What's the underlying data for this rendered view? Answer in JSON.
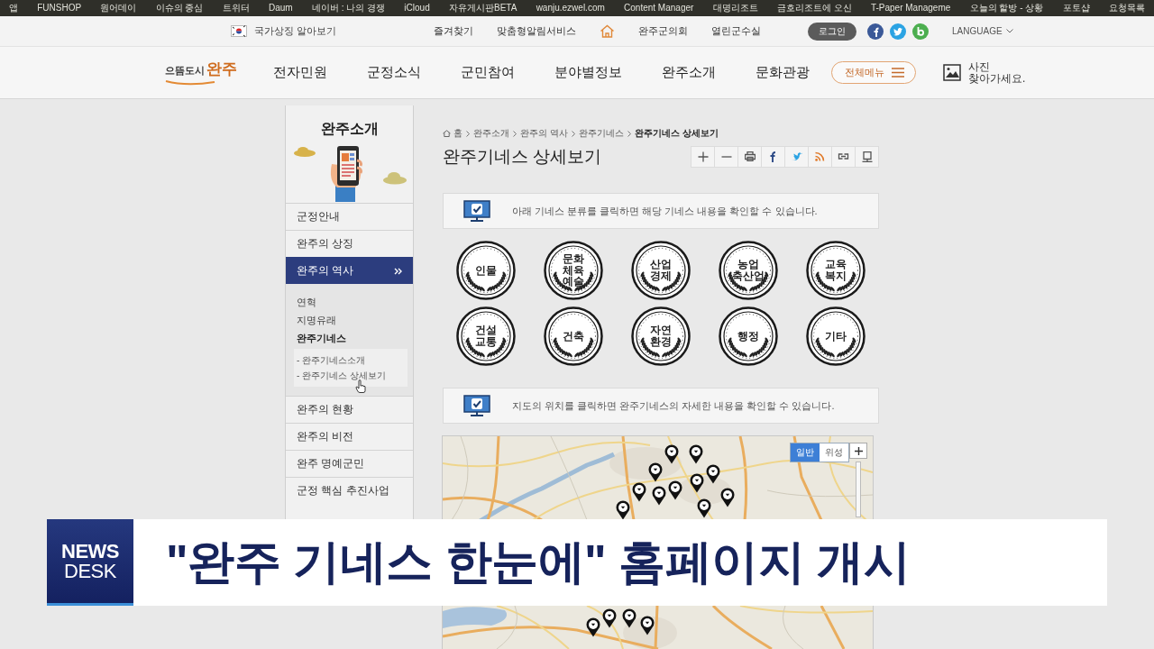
{
  "bookmarks": [
    "앱",
    "FUNSHOP",
    "원어데이",
    "이슈의 중심",
    "트위터",
    "Daum",
    "네이버 : 나의 경쟁",
    "iCloud",
    "자유게시판BETA",
    "wanju.ezwel.com",
    "Content Manager",
    "대명리조트",
    "금호리조트에 오신",
    "T-Paper Manageme",
    "오늘의 할방 - 상황",
    "포토샵",
    "요청목록"
  ],
  "utility_bar": {
    "national_symbols": "국가상징 알아보기",
    "links": [
      {
        "kind": "text",
        "label": "즐겨찾기"
      },
      {
        "kind": "text",
        "label": "맞춤형알림서비스"
      },
      {
        "kind": "home"
      },
      {
        "kind": "text",
        "label": "완주군의회"
      },
      {
        "kind": "text",
        "label": "열린군수실"
      }
    ],
    "login": "로그인",
    "language": "LANGUAGE"
  },
  "header": {
    "logo": {
      "prefix": "으뜸도시",
      "name": "완주"
    },
    "nav": [
      "전자민원",
      "군정소식",
      "군민참여",
      "분야별정보",
      "완주소개",
      "문화관광"
    ],
    "all_menu": "전체메뉴",
    "photo_search": [
      "사진",
      "찾아가세요."
    ]
  },
  "sidebar": {
    "title": "완주소개",
    "items": [
      {
        "label": "군정안내",
        "selected": false
      },
      {
        "label": "완주의 상징",
        "selected": false
      },
      {
        "label": "완주의 역사",
        "selected": true,
        "children": [
          {
            "label": "연혁",
            "selected": false
          },
          {
            "label": "지명유래",
            "selected": false
          },
          {
            "label": "완주기네스",
            "selected": true,
            "children": [
              {
                "label": "- 완주기네스소개",
                "selected": false
              },
              {
                "label": "- 완주기네스 상세보기",
                "selected": false
              }
            ]
          }
        ]
      },
      {
        "label": "완주의 현황",
        "selected": false
      },
      {
        "label": "완주의 비전",
        "selected": false
      },
      {
        "label": "완주 명예군민",
        "selected": false
      },
      {
        "label": "군정 핵심 추진사업",
        "selected": false
      }
    ]
  },
  "content": {
    "breadcrumb": [
      {
        "label": "홈",
        "current": false
      },
      {
        "label": "완주소개",
        "current": false
      },
      {
        "label": "완주의 역사",
        "current": false
      },
      {
        "label": "완주기네스",
        "current": false
      },
      {
        "label": "완주기네스 상세보기",
        "current": true
      }
    ],
    "title": "완주기네스 상세보기",
    "category_notice": "아래 기네스 분류를 클릭하면 해당 기네스 내용을 확인할 수 있습니다.",
    "categories": [
      {
        "label": "인물"
      },
      {
        "label": "문화\n체육\n예술"
      },
      {
        "label": "산업\n경제"
      },
      {
        "label": "농업\n축산업"
      },
      {
        "label": "교육\n복지"
      },
      {
        "label": "건설\n교통"
      },
      {
        "label": "건축"
      },
      {
        "label": "자연\n환경"
      },
      {
        "label": "행정"
      },
      {
        "label": "기타"
      }
    ],
    "map_notice": "지도의 위치를 클릭하면 완주기네스의 자세한 내용을 확인할 수 있습니다.",
    "map": {
      "view_modes": [
        {
          "label": "일반",
          "selected": true
        },
        {
          "label": "위성",
          "selected": false
        }
      ]
    }
  },
  "caption": {
    "program_logo": [
      "NEWS",
      "DESK"
    ],
    "headline": "\"완주 기네스 한눈에\" 홈페이지 개시"
  }
}
